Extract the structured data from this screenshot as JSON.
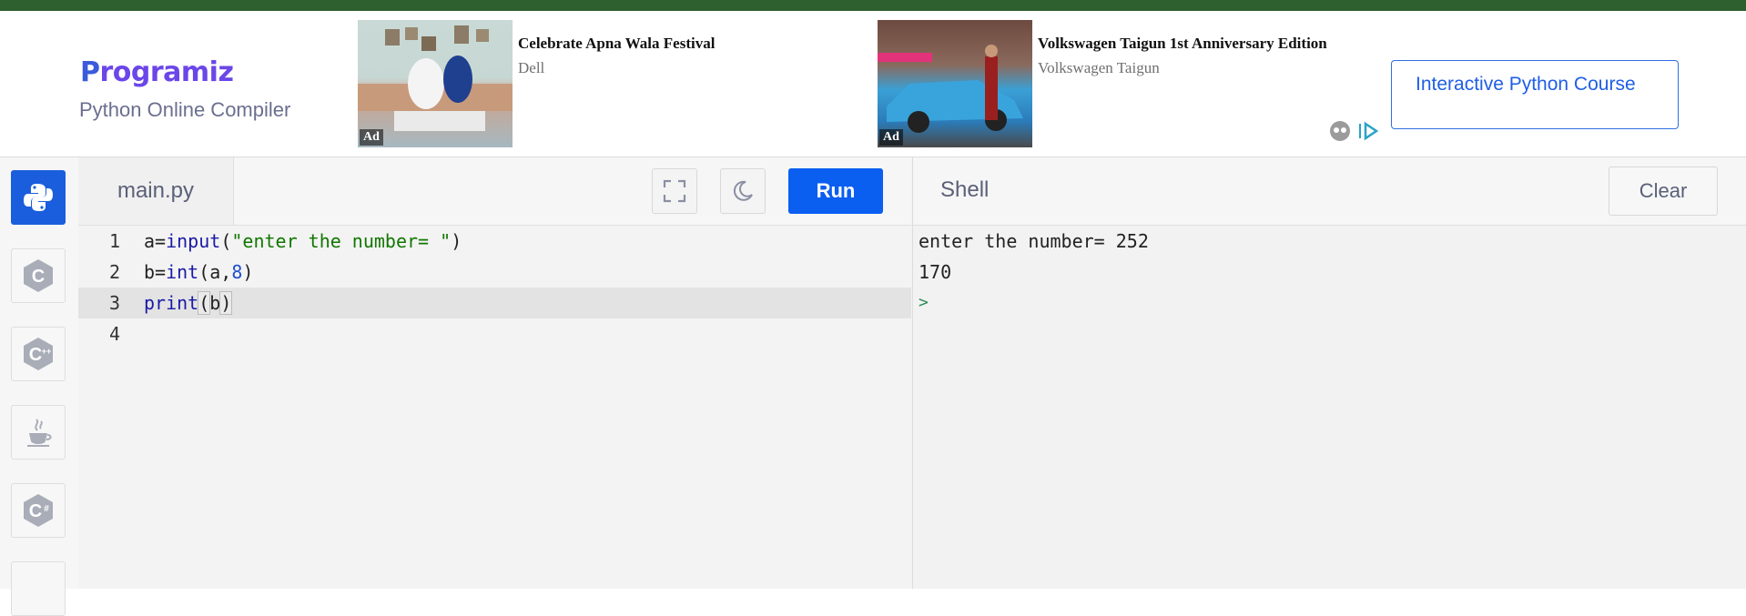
{
  "header": {
    "logo_text": "rogramiz",
    "logo_letter": "P",
    "subtitle": "Python Online Compiler",
    "ads": [
      {
        "badge": "Ad",
        "title": "Celebrate Apna Wala Festival",
        "advertiser": "Dell"
      },
      {
        "badge": "Ad",
        "title": "Volkswagen Taigun 1st Anniversary Edition",
        "advertiser": "Volkswagen Taigun"
      }
    ],
    "course_button": "Interactive Python Course"
  },
  "languages": [
    "python-icon",
    "c-icon",
    "cpp-icon",
    "java-icon",
    "csharp-icon"
  ],
  "editor": {
    "file_tab": "main.py",
    "run_label": "Run",
    "current_line": 3,
    "lines": [
      {
        "num": "1",
        "a": "a=",
        "b": "input",
        "c": "(",
        "d": "\"enter the number= \"",
        "e": ")"
      },
      {
        "num": "2",
        "a": "b=",
        "b": "int",
        "c": "(a,",
        "d": "8",
        "e": ")"
      },
      {
        "num": "3",
        "a": "",
        "b": "print",
        "c": "(",
        "d": "b",
        "e": ")"
      },
      {
        "num": "4",
        "a": "",
        "b": "",
        "c": "",
        "d": "",
        "e": ""
      }
    ]
  },
  "shell": {
    "title": "Shell",
    "clear_label": "Clear",
    "output": [
      "enter the number= 252",
      "170"
    ],
    "prompt": ">"
  }
}
